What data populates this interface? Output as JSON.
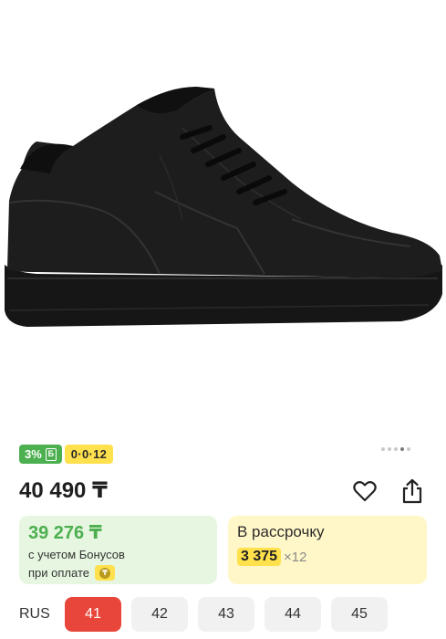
{
  "image": {
    "alt_icon": "shoe-image"
  },
  "gallery": {
    "dots": [
      false,
      false,
      false,
      true,
      false
    ]
  },
  "badges": {
    "bonus": "3%",
    "bonus_icon": "Б",
    "installment": "0·0·12"
  },
  "price": {
    "main": "40 490 ₸"
  },
  "actions": {
    "favorite_icon": "heart-icon",
    "share_icon": "share-icon"
  },
  "bonus_card": {
    "price": "39 276 ₸",
    "line1": "с учетом Бонусов",
    "line2": "при оплате",
    "pay_icon": "₸"
  },
  "installment_card": {
    "title": "В рассрочку",
    "amount": "3 375",
    "multiplier": "×12"
  },
  "sizes": {
    "label": "RUS",
    "items": [
      {
        "label": "41",
        "selected": true
      },
      {
        "label": "42",
        "selected": false
      },
      {
        "label": "43",
        "selected": false
      },
      {
        "label": "44",
        "selected": false
      },
      {
        "label": "45",
        "selected": false
      }
    ]
  },
  "colors": {
    "accent_red": "#e8463a",
    "bonus_green": "#4caf50",
    "install_yellow": "#ffe14d"
  }
}
